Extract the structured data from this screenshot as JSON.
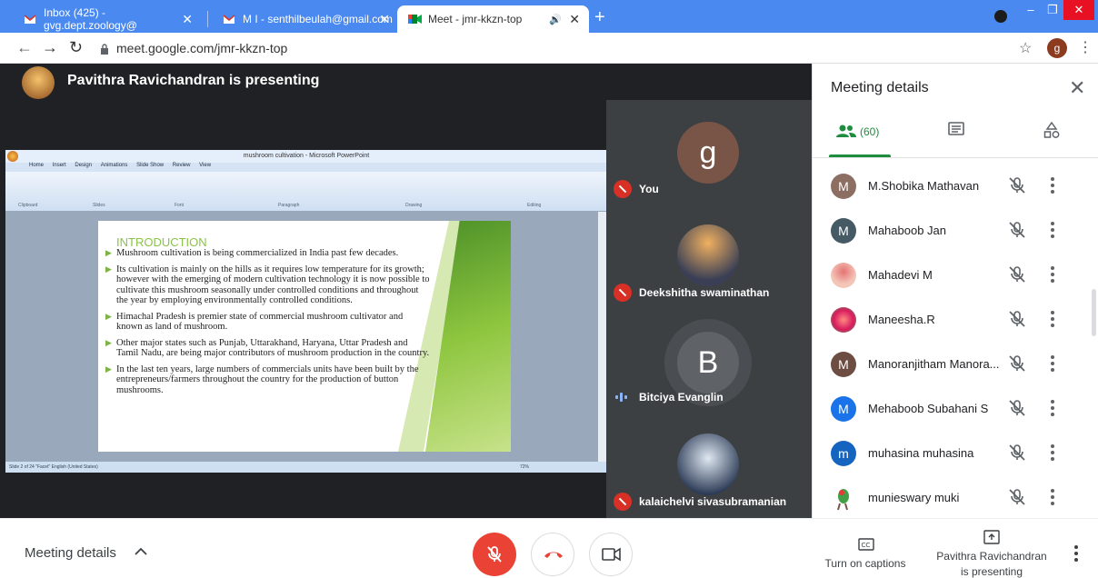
{
  "browser": {
    "tabs": [
      {
        "title": "Inbox (425) - gvg.dept.zoology@",
        "active": false
      },
      {
        "title": "M I - senthilbeulah@gmail.com",
        "active": false
      },
      {
        "title": "Meet - jmr-kkzn-top",
        "active": true
      }
    ],
    "url": "meet.google.com/jmr-kkzn-top",
    "profile_initial": "g"
  },
  "presentation": {
    "presenter_banner": "Pavithra Ravichandran is presenting",
    "ppt_window_title": "mushroom cultivation - Microsoft PowerPoint",
    "ppt_menu": [
      "Home",
      "Insert",
      "Design",
      "Animations",
      "Slide Show",
      "Review",
      "View"
    ],
    "ppt_ribbon_groups": [
      "Clipboard",
      "Slides",
      "Font",
      "Paragraph",
      "Drawing",
      "Editing"
    ],
    "ppt_status": "Slide 2 of 24   \"Facet\"   English (United States)",
    "ppt_zoom": "72%",
    "slide": {
      "title": "INTRODUCTION",
      "bullets": [
        "Mushroom cultivation is being commercialized in India past few decades.",
        "Its cultivation is mainly on the hills as it requires low temperature for its growth; however with the emerging of modern cultivation technology it is now possible to cultivate this mushroom seasonally under controlled conditions and throughout the year by employing environmentally controlled conditions.",
        "Himachal Pradesh is premier state of commercial mushroom cultivator and known as land of mushroom.",
        "Other major states such as Punjab, Uttarakhand, Haryana, Uttar Pradesh and Tamil Nadu, are being major contributors of mushroom production in the country.",
        "In the last ten years, large numbers of commercials units have been built by the entrepreneurs/farmers throughout the country for the production of button mushrooms."
      ]
    }
  },
  "tiles": [
    {
      "name": "You",
      "initial": "g",
      "muted": true,
      "color": "#795548"
    },
    {
      "name": "Deekshitha swaminathan",
      "initial": "",
      "muted": true,
      "color": "#2c3e50"
    },
    {
      "name": "Bitciya Evanglin",
      "initial": "B",
      "muted": false,
      "color": "#5f6368"
    },
    {
      "name": "kalaichelvi sivasubramanian",
      "initial": "",
      "muted": true,
      "color": "#7f97b5"
    }
  ],
  "panel": {
    "title": "Meeting details",
    "people_count": "(60)",
    "participants": [
      {
        "name": "M.Shobika Mathavan",
        "initial": "M",
        "color": "#8d6e63"
      },
      {
        "name": "Mahaboob Jan",
        "initial": "M",
        "color": "#455a64"
      },
      {
        "name": "Mahadevi M",
        "initial": "",
        "color": "#f4c6b8"
      },
      {
        "name": "Maneesha.R",
        "initial": "",
        "color": "#e53950"
      },
      {
        "name": "Manoranjitham Manora...",
        "initial": "M",
        "color": "#6d4c41"
      },
      {
        "name": "Mehaboob Subahani S",
        "initial": "M",
        "color": "#1a73e8"
      },
      {
        "name": "muhasina muhasina",
        "initial": "m",
        "color": "#1565c0"
      },
      {
        "name": "munieswary muki",
        "initial": "",
        "color": "#ffffff"
      }
    ]
  },
  "bottom": {
    "meeting_details": "Meeting details",
    "captions_label": "Turn on captions",
    "presenting_label_1": "Pavithra Ravichandran",
    "presenting_label_2": "is presenting"
  },
  "colors": {
    "accent_red": "#ea4335",
    "meet_green": "#1e8e3e",
    "chrome_blue": "#4a89f0"
  }
}
